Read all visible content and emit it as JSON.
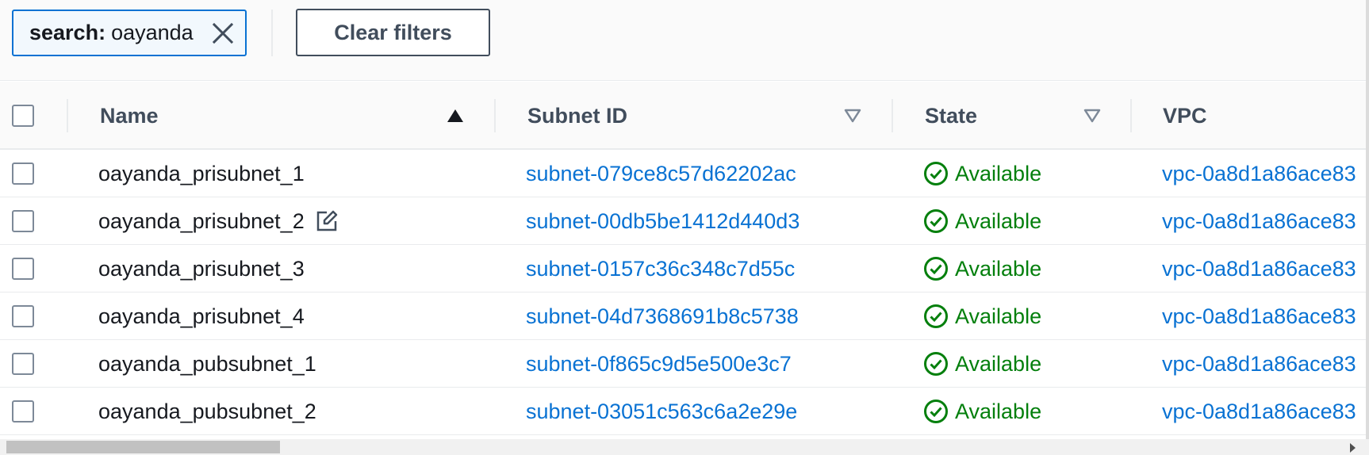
{
  "filter": {
    "token_key": "search:",
    "token_value": "oayanda",
    "clear_label": "Clear filters"
  },
  "table": {
    "columns": {
      "name": "Name",
      "subnet_id": "Subnet ID",
      "state": "State",
      "vpc": "VPC"
    },
    "sort": {
      "column": "Name",
      "direction": "ascending"
    },
    "rows": [
      {
        "name": "oayanda_prisubnet_1",
        "subnet_id": "subnet-079ce8c57d62202ac",
        "state": "Available",
        "vpc": "vpc-0a8d1a86ace83"
      },
      {
        "name": "oayanda_prisubnet_2",
        "subnet_id": "subnet-00db5be1412d440d3",
        "state": "Available",
        "vpc": "vpc-0a8d1a86ace83"
      },
      {
        "name": "oayanda_prisubnet_3",
        "subnet_id": "subnet-0157c36c348c7d55c",
        "state": "Available",
        "vpc": "vpc-0a8d1a86ace83"
      },
      {
        "name": "oayanda_prisubnet_4",
        "subnet_id": "subnet-04d7368691b8c5738",
        "state": "Available",
        "vpc": "vpc-0a8d1a86ace83"
      },
      {
        "name": "oayanda_pubsubnet_1",
        "subnet_id": "subnet-0f865c9d5e500e3c7",
        "state": "Available",
        "vpc": "vpc-0a8d1a86ace83"
      },
      {
        "name": "oayanda_pubsubnet_2",
        "subnet_id": "subnet-03051c563c6a2e29e",
        "state": "Available",
        "vpc": "vpc-0a8d1a86ace83"
      }
    ]
  },
  "colors": {
    "link": "#0972d3",
    "success": "#037f0c",
    "token_border": "#0972d3",
    "header_text": "#414d5c"
  }
}
